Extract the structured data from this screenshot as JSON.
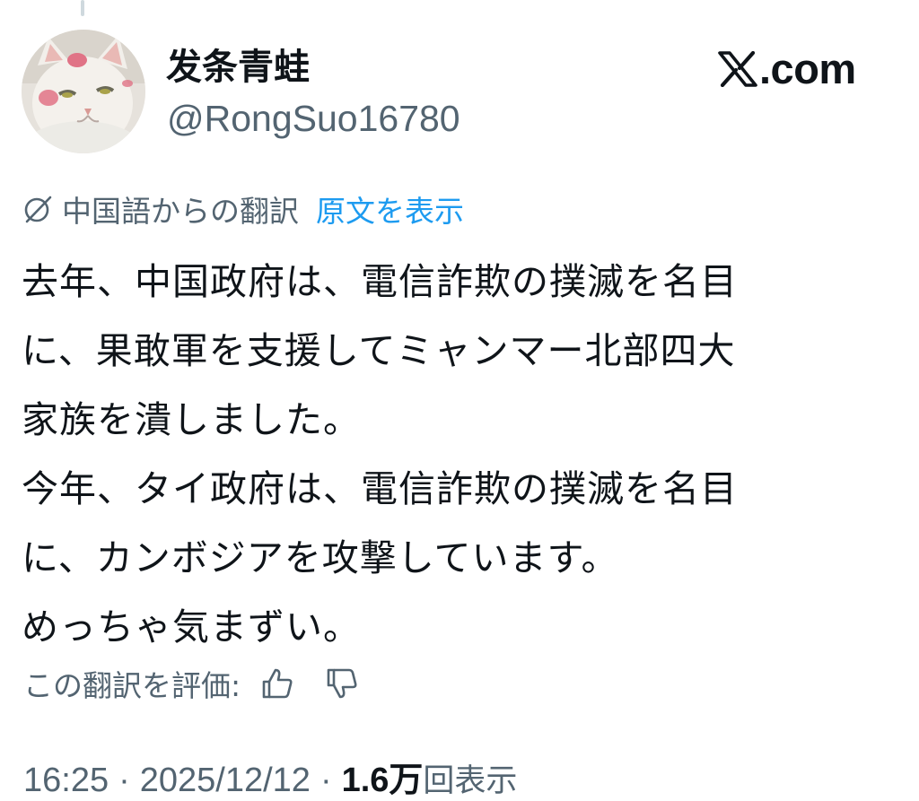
{
  "author": {
    "display_name": "发条青蛙",
    "handle": "@RongSuo16780",
    "avatar_icon": "cat-avatar"
  },
  "brand": {
    "name": ".com",
    "icon": "x-logo-icon"
  },
  "translation": {
    "icon": "globe-icon",
    "from_label": "中国語からの翻訳",
    "show_original": "原文を表示"
  },
  "tweet": {
    "lines": [
      "去年、中国政府は、電信詐欺の撲滅を名目",
      "に、果敢軍を支援してミャンマー北部四大",
      "家族を潰しました。",
      "今年、タイ政府は、電信詐欺の撲滅を名目",
      "に、カンボジアを攻撃しています。",
      "めっちゃ気まずい。"
    ]
  },
  "rating": {
    "label": "この翻訳を評価:",
    "up_icon": "thumbs-up-icon",
    "down_icon": "thumbs-down-icon"
  },
  "meta": {
    "time": "16:25",
    "separator": "·",
    "date": "2025/12/12",
    "views_count": "1.6万",
    "views_label": "回表示"
  },
  "colors": {
    "text": "#0f1419",
    "secondary": "#536471",
    "link": "#1d9bf0"
  }
}
